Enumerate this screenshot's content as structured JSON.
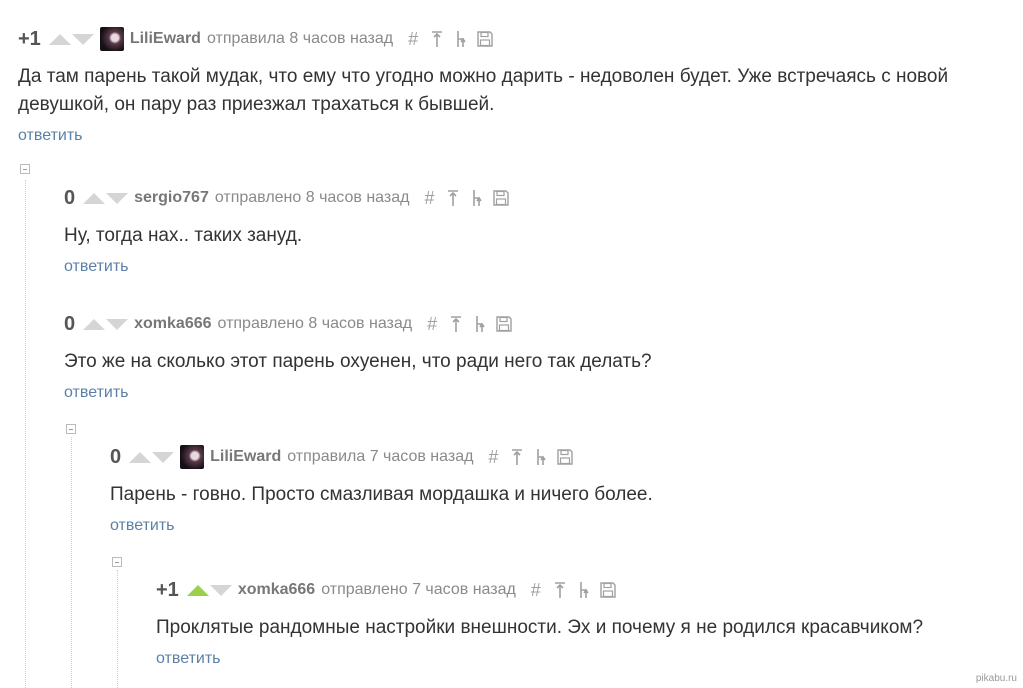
{
  "comments": [
    {
      "rating": "+1",
      "username": "LiliEward",
      "meta": "отправила 8 часов назад",
      "text": "Да там парень такой мудак, что ему что угодно можно дарить - недоволен будет. Уже встречаясь с новой девушкой, он пару раз приезжал трахаться к бывшей.",
      "reply": "ответить",
      "has_avatar": true
    },
    {
      "rating": "0",
      "username": "sergio767",
      "meta": "отправлено 8 часов назад",
      "text": "Ну, тогда нах.. таких зануд.",
      "reply": "ответить",
      "has_avatar": false
    },
    {
      "rating": "0",
      "username": "xomka666",
      "meta": "отправлено 8 часов назад",
      "text": "Это же на сколько этот парень охуенен, что ради него так делать?",
      "reply": "ответить",
      "has_avatar": false
    },
    {
      "rating": "0",
      "username": "LiliEward",
      "meta": "отправила 7 часов назад",
      "text": "Парень - говно. Просто смазливая мордашка и ничего более.",
      "reply": "ответить",
      "has_avatar": true
    },
    {
      "rating": "+1",
      "username": "xomka666",
      "meta": "отправлено 7 часов назад",
      "text": "Проклятые рандомные настройки внешности. Эх и почему я не родился красавчиком?",
      "reply": "ответить",
      "has_avatar": false,
      "upvoted": true
    }
  ],
  "icons": [
    "hash-icon",
    "jump-to-parent-icon",
    "jump-to-branch-icon",
    "save-icon"
  ],
  "colors": {
    "reply_link": "#5b80a8",
    "upvote_active": "#9ad04a",
    "arrow_inactive": "#d5d5d5"
  },
  "watermark": "pikabu.ru"
}
